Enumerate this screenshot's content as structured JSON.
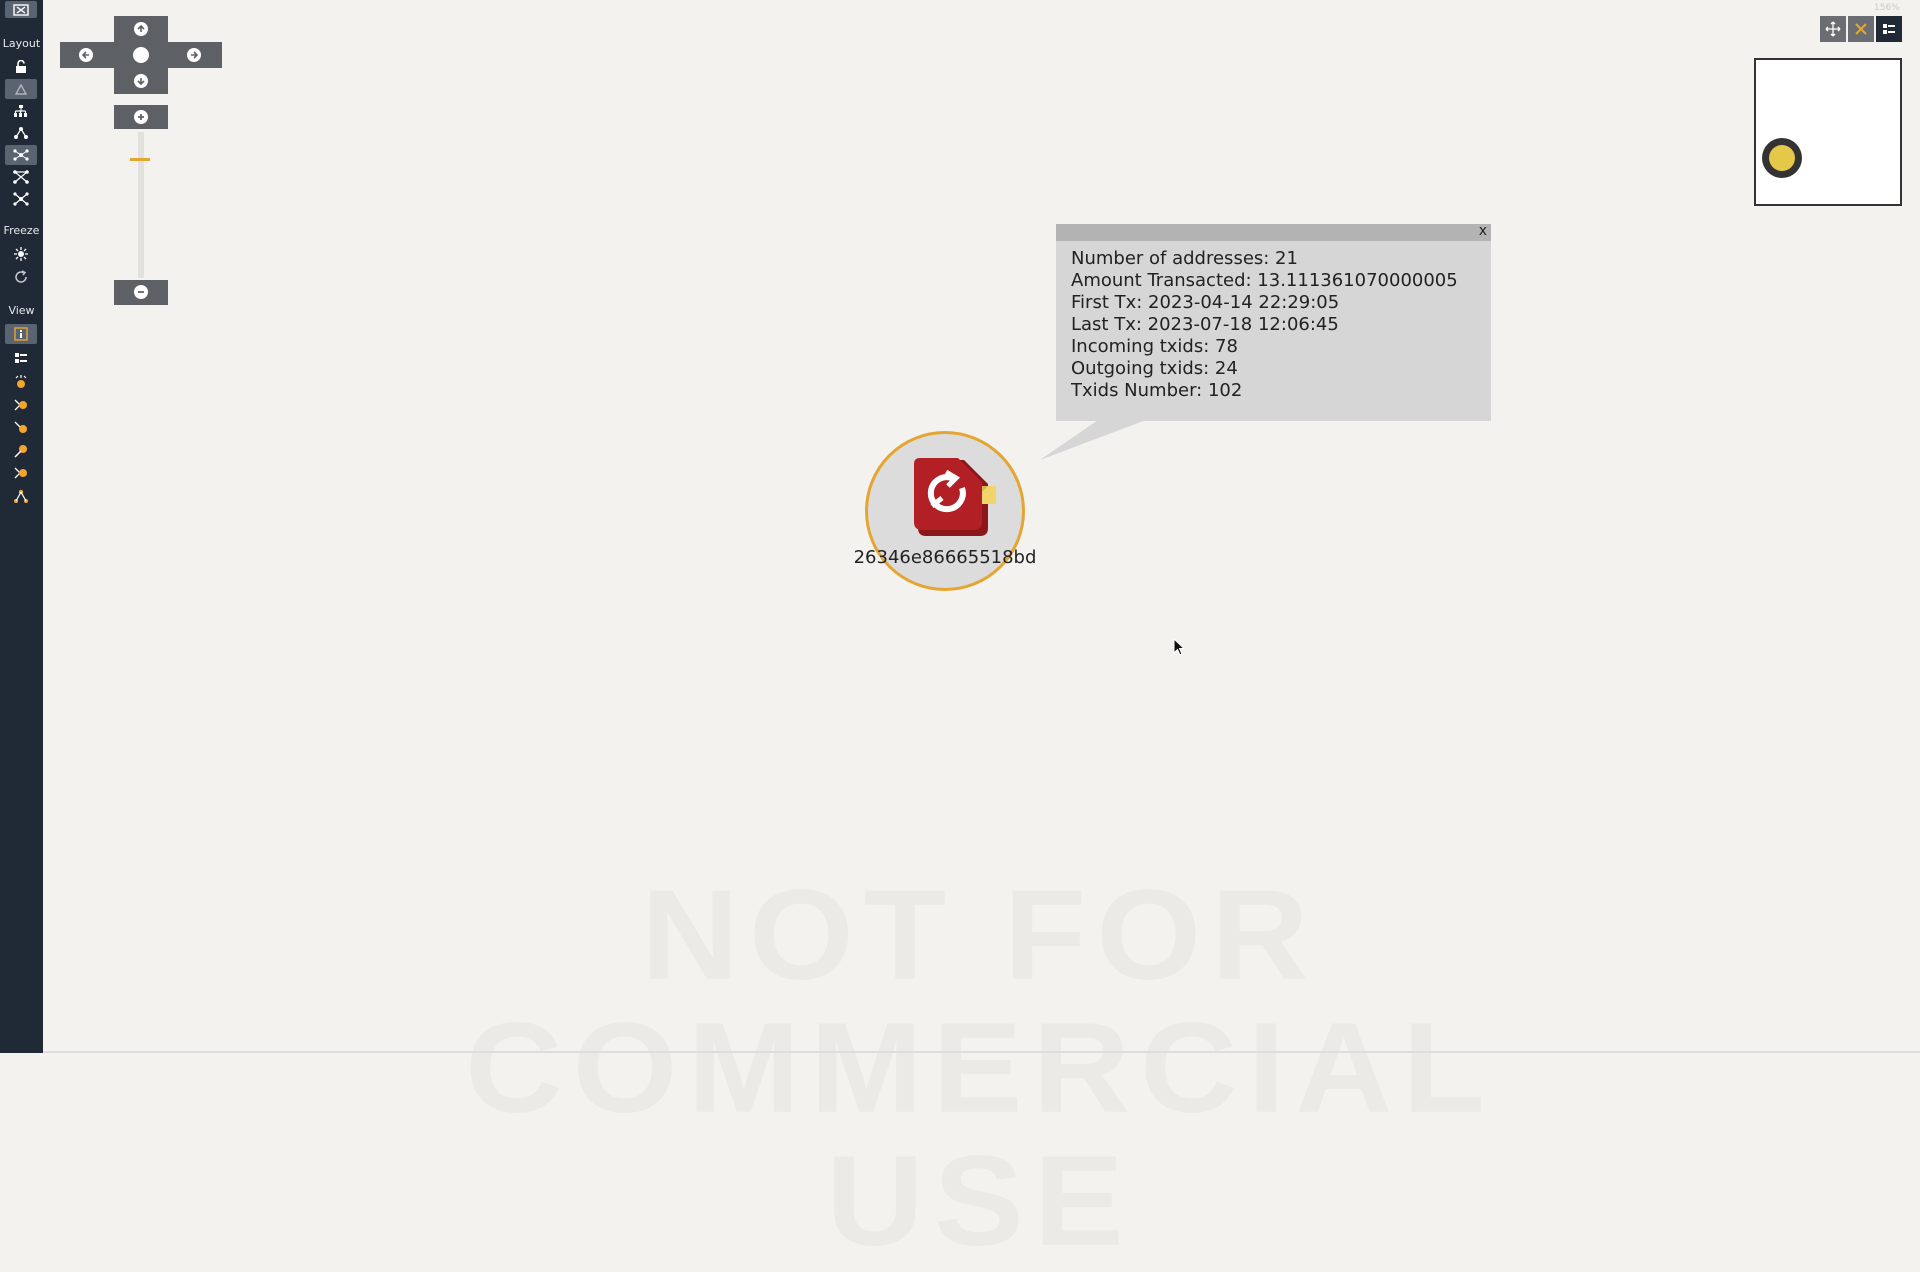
{
  "toolbar": {
    "sections": {
      "layout": "Layout",
      "freeze": "Freeze",
      "view": "View"
    },
    "top_icon": "grid-icon",
    "layout_buttons": [
      "lock-icon",
      "org-tree-icon",
      "hierarchy-icon",
      "hub-icon",
      "network-icon",
      "cross-network-icon",
      "star-network-icon"
    ],
    "freeze_buttons": [
      "sun-icon",
      "refresh-icon"
    ],
    "view_buttons": [
      "info-icon",
      "list-icon",
      "crown-node-icon",
      "branch-node-icon",
      "link-node-icon",
      "pin-icon",
      "split-node-icon",
      "tree-node-icon"
    ]
  },
  "navigator": {
    "up": "up-icon",
    "down": "down-icon",
    "left": "left-icon",
    "right": "right-icon",
    "zoom_in": "zoom-in-icon",
    "zoom_out": "zoom-out-icon",
    "zoom_level": 0.2
  },
  "top_right": {
    "zoom_text": "156%",
    "buttons": [
      "fit-icon",
      "close-x-icon",
      "list-toggle-icon"
    ]
  },
  "tooltip": {
    "close_label": "x",
    "lines": [
      "Number of addresses: 21",
      "Amount Transacted: 13.111361070000005",
      "First Tx: 2023-04-14 22:29:05",
      "Last Tx: 2023-07-18 12:06:45",
      "Incoming txids: 78",
      "Outgoing txids: 24",
      "Txids Number: 102"
    ]
  },
  "node": {
    "label": "26346e86665518bd",
    "icon": "wallet-cluster-icon",
    "ring_color": "#e5a532",
    "icon_color": "#b21f24"
  },
  "watermark": "NOT FOR COMMERCIAL USE",
  "minimap": {
    "node_color": "#e5c84a"
  }
}
